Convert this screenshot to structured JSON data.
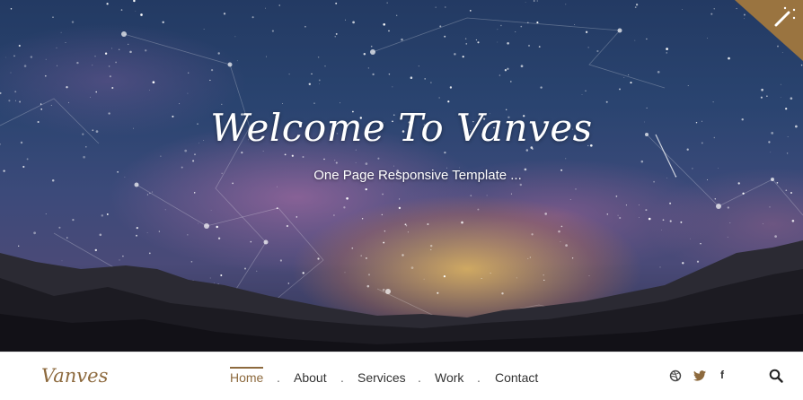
{
  "hero": {
    "title": "Welcome To Vanves",
    "subtitle": "One Page Responsive Template ..."
  },
  "corner_badge": {
    "icon": "magic-wand-icon",
    "color": "#9a7440"
  },
  "nav": {
    "brand": "Vanves",
    "items": [
      {
        "label": "Home",
        "active": true
      },
      {
        "label": "About",
        "active": false
      },
      {
        "label": "Services",
        "active": false
      },
      {
        "label": "Work",
        "active": false
      },
      {
        "label": "Contact",
        "active": false
      }
    ],
    "separator": ".",
    "social": [
      {
        "icon": "dribbble-icon"
      },
      {
        "icon": "twitter-icon"
      },
      {
        "icon": "facebook-icon",
        "text": "f"
      }
    ],
    "search_icon": "search-icon"
  },
  "colors": {
    "accent": "#8d6a3e",
    "nav_text": "#333333",
    "hero_text": "#ffffff"
  }
}
